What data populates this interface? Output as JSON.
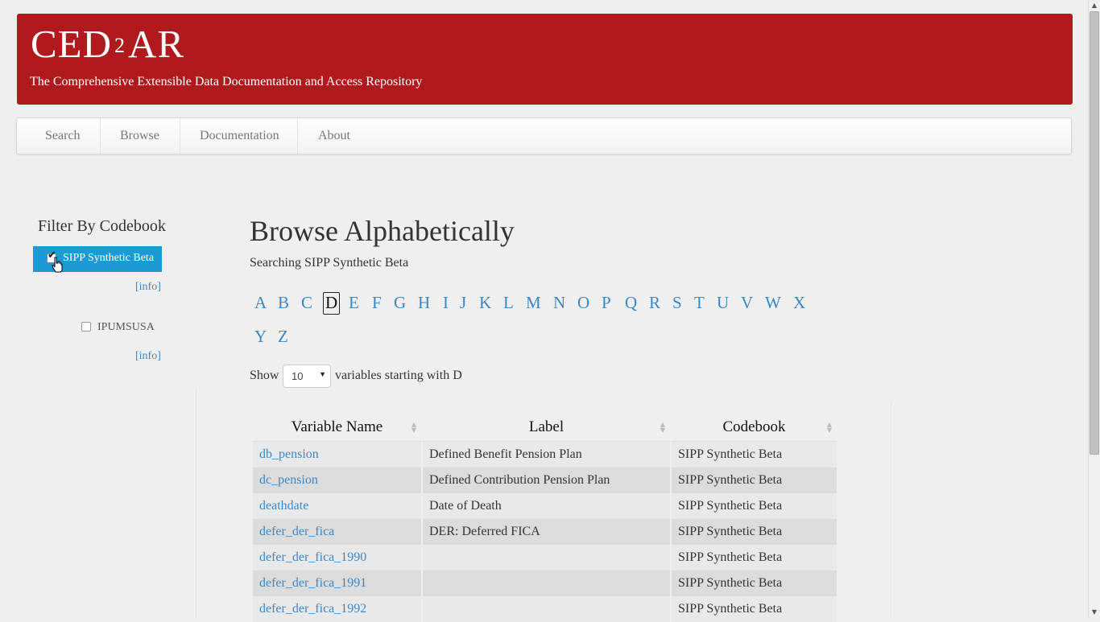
{
  "header": {
    "logo_pre": "CED",
    "logo_sup": "2",
    "logo_post": "AR",
    "tagline": "The Comprehensive Extensible Data Documentation and Access Repository"
  },
  "nav": {
    "items": [
      {
        "label": "Search"
      },
      {
        "label": "Browse"
      },
      {
        "label": "Documentation"
      },
      {
        "label": "About"
      }
    ]
  },
  "sidebar": {
    "title": "Filter By Codebook",
    "codebooks": [
      {
        "label": "SIPP Synthetic Beta",
        "checked": true,
        "info": "[info]"
      },
      {
        "label": "IPUMSUSA",
        "checked": false,
        "info": "[info]"
      }
    ]
  },
  "main": {
    "title": "Browse Alphabetically",
    "searching": "Searching SIPP Synthetic Beta",
    "letters": [
      "A",
      "B",
      "C",
      "D",
      "E",
      "F",
      "G",
      "H",
      "I",
      "J",
      "K",
      "L",
      "M",
      "N",
      "O",
      "P",
      "Q",
      "R",
      "S",
      "T",
      "U",
      "V",
      "W",
      "X",
      "Y",
      "Z"
    ],
    "active_letter": "D",
    "show_label": "Show",
    "show_value": "10",
    "show_suffix": "variables starting with D"
  },
  "table": {
    "headers": [
      "Variable Name",
      "Label",
      "Codebook"
    ],
    "rows": [
      {
        "name": "db_pension",
        "label": "Defined Benefit Pension Plan",
        "codebook": "SIPP Synthetic Beta"
      },
      {
        "name": "dc_pension",
        "label": "Defined Contribution Pension Plan",
        "codebook": "SIPP Synthetic Beta"
      },
      {
        "name": "deathdate",
        "label": "Date of Death",
        "codebook": "SIPP Synthetic Beta"
      },
      {
        "name": "defer_der_fica",
        "label": "DER: Deferred FICA",
        "codebook": "SIPP Synthetic Beta"
      },
      {
        "name": "defer_der_fica_1990",
        "label": "",
        "codebook": "SIPP Synthetic Beta"
      },
      {
        "name": "defer_der_fica_1991",
        "label": "",
        "codebook": "SIPP Synthetic Beta"
      },
      {
        "name": "defer_der_fica_1992",
        "label": "",
        "codebook": "SIPP Synthetic Beta"
      }
    ]
  },
  "colors": {
    "header_bg": "#b01a1d",
    "link": "#3a87c7",
    "selected_bg": "#1b9ad6"
  }
}
